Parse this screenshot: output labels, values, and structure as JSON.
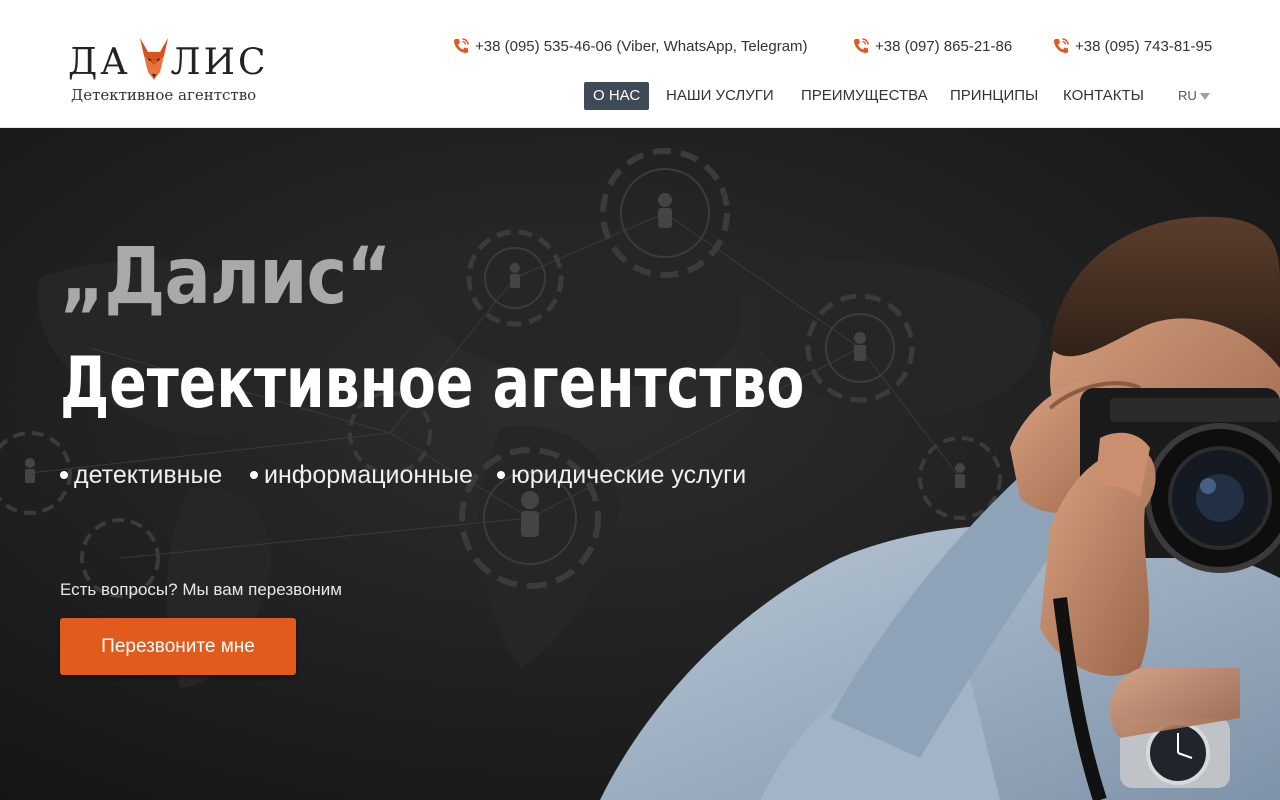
{
  "brand": {
    "title_left": "ДА",
    "title_right": "ЛИС",
    "subtitle": "Детективное агентство"
  },
  "phones": [
    "+38 (095) 535-46-06 (Viber, WhatsApp, Telegram)",
    "+38 (097) 865-21-86",
    "+38 (095) 743-81-95"
  ],
  "nav": {
    "items": [
      "О НАС",
      "НАШИ УСЛУГИ",
      "ПРЕИМУЩЕСТВА",
      "ПРИНЦИПЫ",
      "КОНТАКТЫ"
    ],
    "active": "О НАС",
    "language": "RU"
  },
  "hero": {
    "quote_title": "„Далис“",
    "title": "Детективное агентство",
    "bullets": [
      "детективные",
      "информационные",
      "юридические услуги"
    ],
    "question": "Есть вопросы? Мы вам перезвоним",
    "cta_label": "Перезвоните мне"
  },
  "colors": {
    "accent": "#e25a1c",
    "nav_active_bg": "#3f4a57",
    "hero_bg": "#1c1c1c",
    "phone_icon": "#e25a1c"
  },
  "icons": {
    "phone": "phone-icon",
    "language_caret": "chevron-down-icon",
    "logo_mark": "fox-logo-icon"
  }
}
